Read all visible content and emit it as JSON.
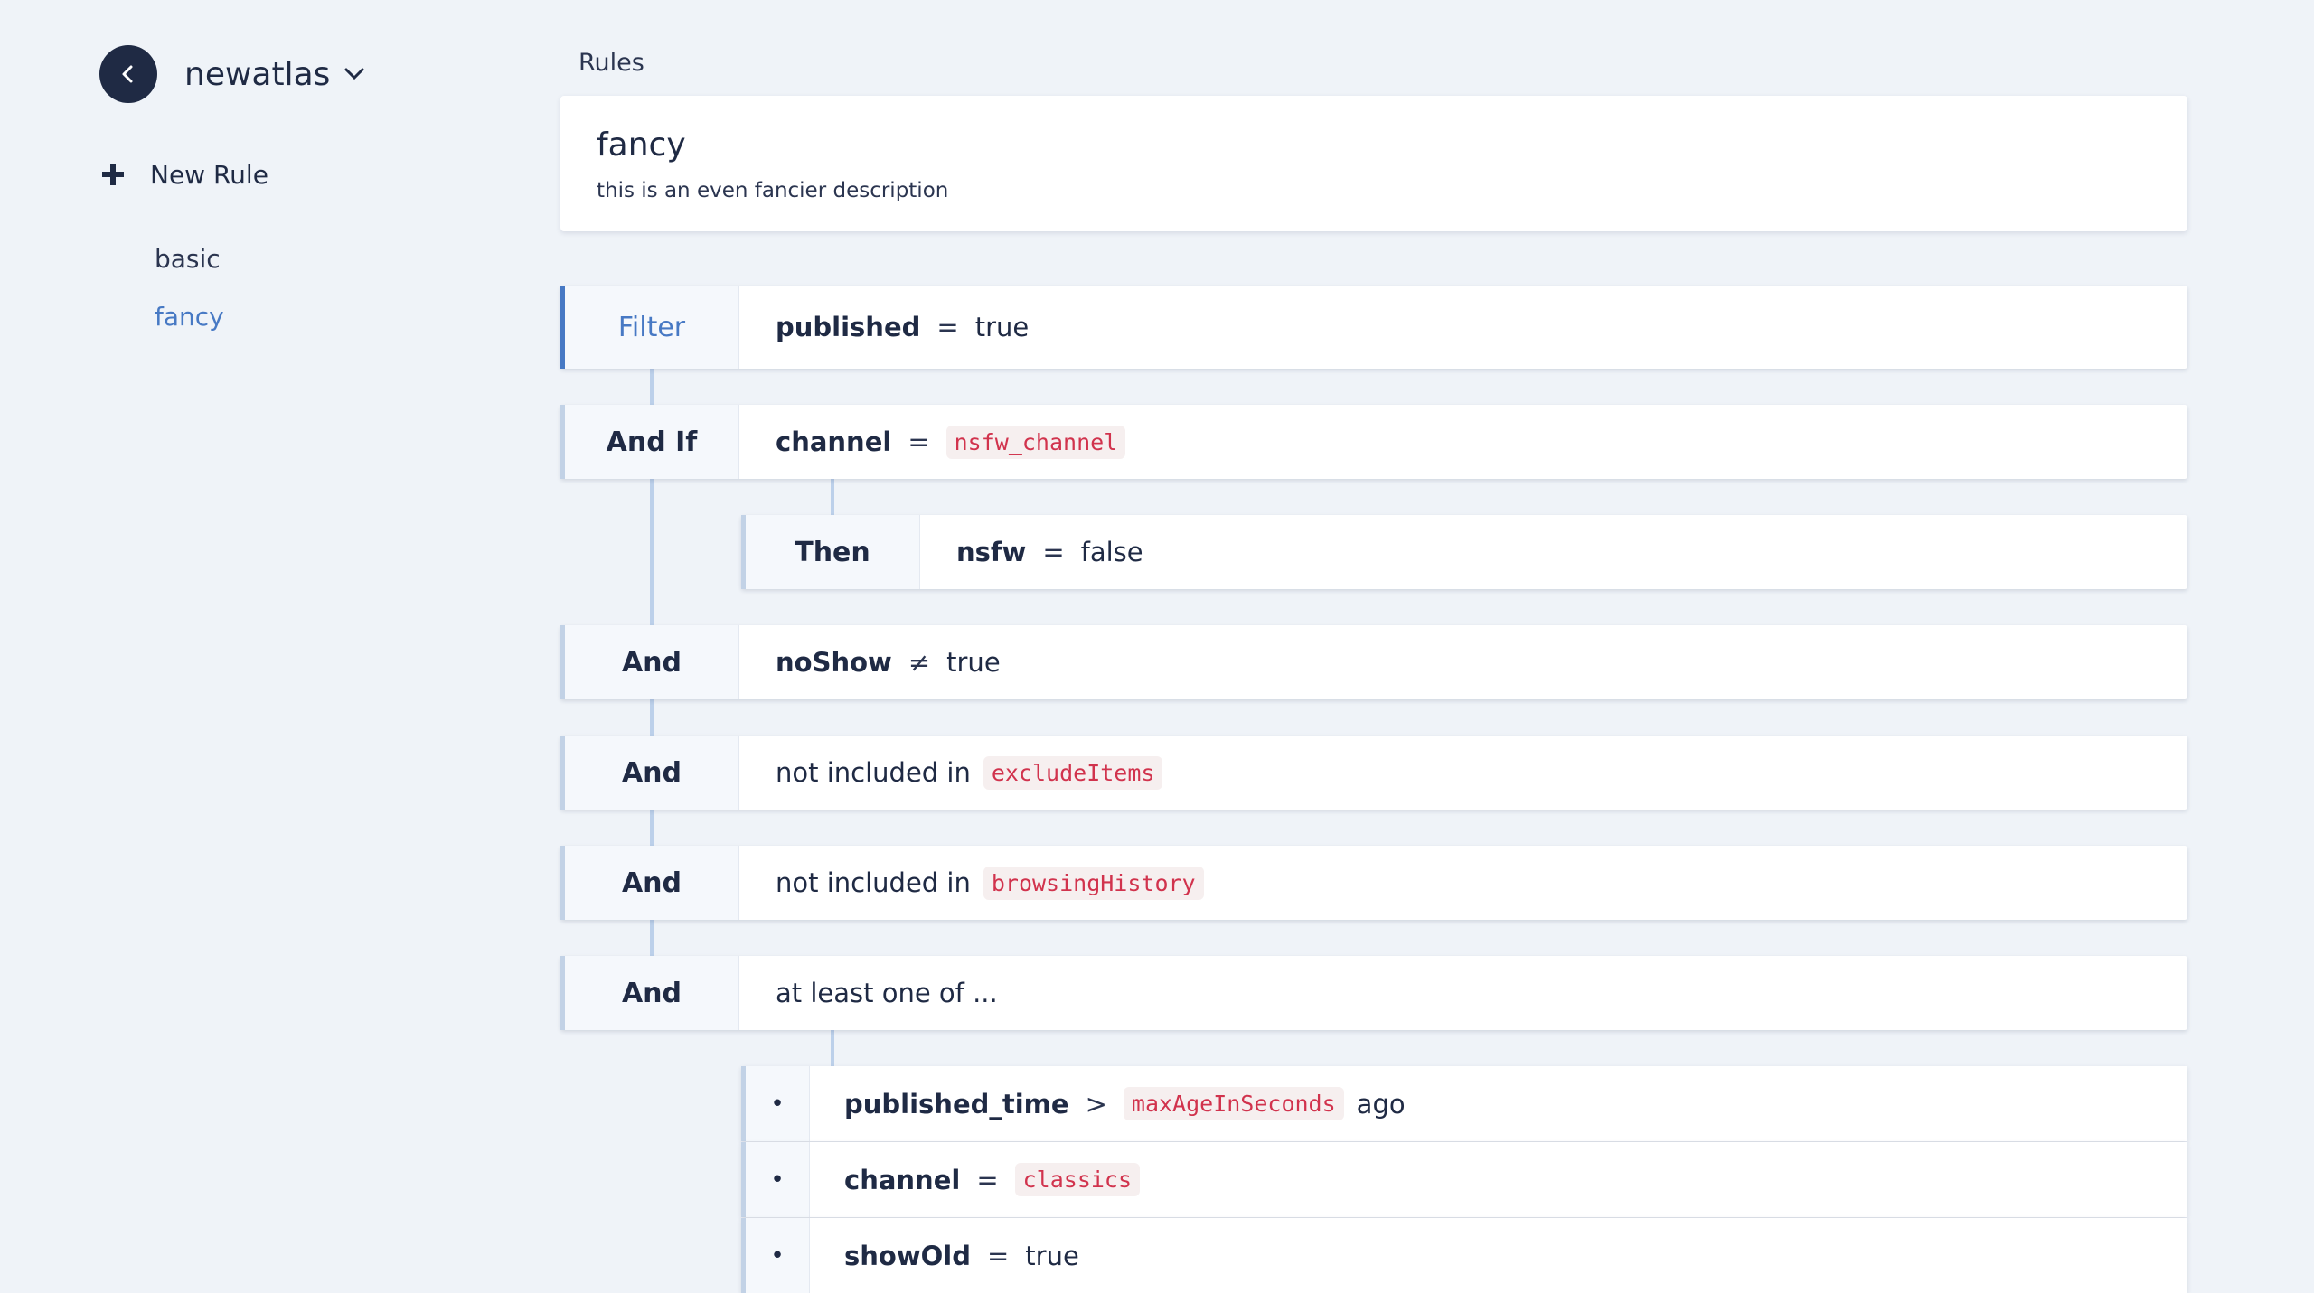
{
  "sidebar": {
    "project": "newatlas",
    "new_rule": "New Rule",
    "items": [
      {
        "label": "basic",
        "active": false
      },
      {
        "label": "fancy",
        "active": true
      }
    ]
  },
  "header": {
    "section": "Rules"
  },
  "rule": {
    "title": "fancy",
    "description": "this is an even fancier description"
  },
  "conditions": {
    "filter": {
      "label": "Filter",
      "field": "published",
      "op": "=",
      "value": "true"
    },
    "and_if": {
      "label": "And If",
      "field": "channel",
      "op": "=",
      "value": "nsfw_channel"
    },
    "then": {
      "label": "Then",
      "field": "nsfw",
      "op": "=",
      "value": "false"
    },
    "and1": {
      "label": "And",
      "field": "noShow",
      "op": "≠",
      "value": "true"
    },
    "and2": {
      "label": "And",
      "text": "not included in",
      "value": "excludeItems"
    },
    "and3": {
      "label": "And",
      "text": "not included in",
      "value": "browsingHistory"
    },
    "and4": {
      "label": "And",
      "text": "at least one of ..."
    },
    "any_of": [
      {
        "bullet": "•",
        "field": "published_time",
        "op": ">",
        "value": "maxAgeInSeconds",
        "suffix": "ago"
      },
      {
        "bullet": "•",
        "field": "channel",
        "op": "=",
        "value": "classics"
      },
      {
        "bullet": "•",
        "field": "showOld",
        "op": "=",
        "value": "true"
      }
    ]
  },
  "colors": {
    "accent": "#4779c4",
    "dark": "#1f2a44",
    "code": "#d1334d"
  }
}
